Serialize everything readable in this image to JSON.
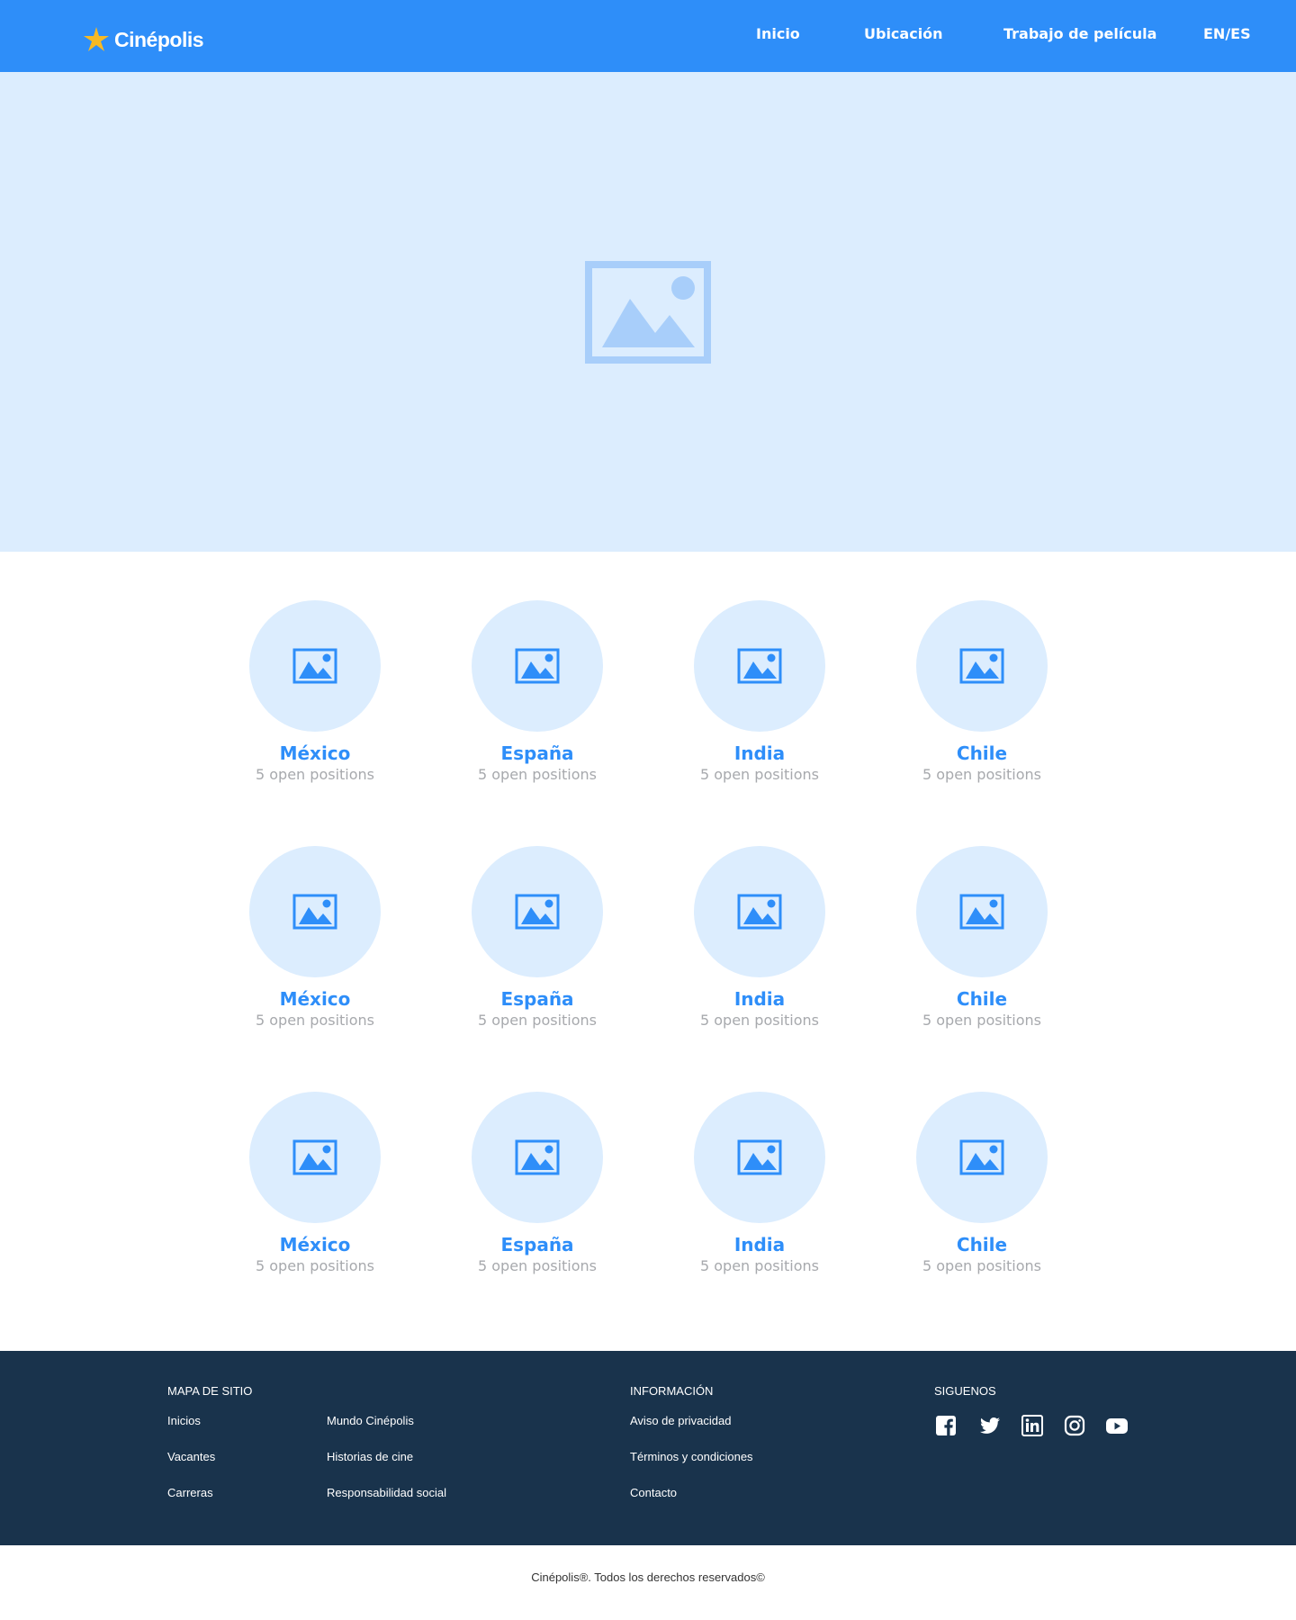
{
  "header": {
    "logo_text": "Cinépolis",
    "nav": [
      "Inicio",
      "Ubicación",
      "Trabajo de película",
      "EN/ES"
    ]
  },
  "hero": {
    "icon": "image-placeholder-icon"
  },
  "locations": [
    {
      "name": "México",
      "positions": "5 open positions"
    },
    {
      "name": "España",
      "positions": "5 open positions"
    },
    {
      "name": "India",
      "positions": "5 open positions"
    },
    {
      "name": "Chile",
      "positions": "5 open positions"
    },
    {
      "name": "México",
      "positions": "5 open positions"
    },
    {
      "name": "España",
      "positions": "5 open positions"
    },
    {
      "name": "India",
      "positions": "5 open positions"
    },
    {
      "name": "Chile",
      "positions": "5 open positions"
    },
    {
      "name": "México",
      "positions": "5 open positions"
    },
    {
      "name": "España",
      "positions": "5 open positions"
    },
    {
      "name": "India",
      "positions": "5 open positions"
    },
    {
      "name": "Chile",
      "positions": "5 open positions"
    }
  ],
  "footer": {
    "sitemap_heading": "MAPA DE SITIO",
    "sitemap_col1": [
      "Inicios",
      "Vacantes",
      "Carreras"
    ],
    "sitemap_col2": [
      "Mundo Cinépolis",
      "Historias de cine",
      "Responsabilidad social"
    ],
    "info_heading": "INFORMACIÓN",
    "info_links": [
      "Aviso de privacidad",
      "Términos y condiciones",
      "Contacto"
    ],
    "social_heading": "SIGUENOS",
    "social_icons": [
      "facebook-icon",
      "twitter-icon",
      "linkedin-icon",
      "instagram-icon",
      "youtube-icon"
    ]
  },
  "copyright": "Cinépolis®. Todos los derechos reservados©",
  "colors": {
    "brand_blue": "#2e8ef9",
    "light_blue": "#dcedfe",
    "footer_navy": "#19334c",
    "logo_star": "#f7b924"
  }
}
